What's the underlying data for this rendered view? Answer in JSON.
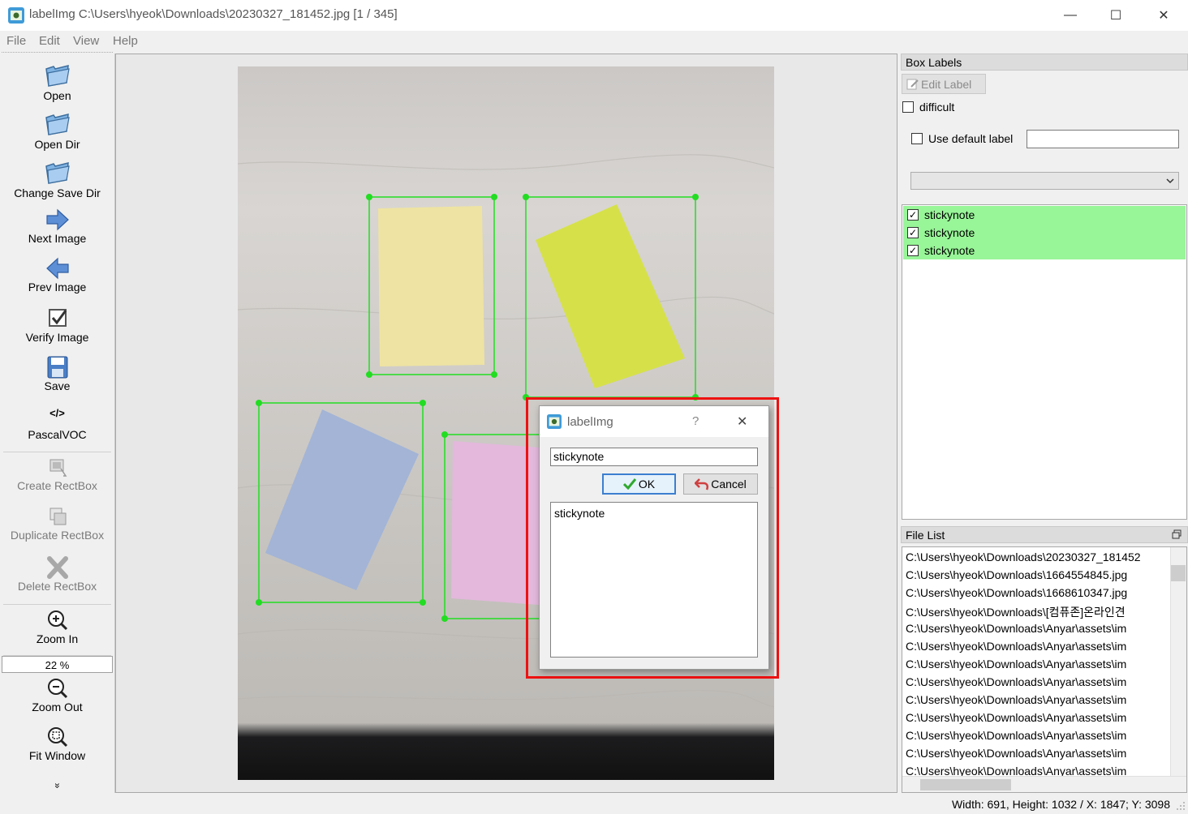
{
  "window": {
    "title": "labelImg C:\\Users\\hyeok\\Downloads\\20230327_181452.jpg [1 / 345]",
    "minimize": "—",
    "maximize": "☐",
    "close": "✕"
  },
  "menu": [
    "File",
    "Edit",
    "View",
    "Help"
  ],
  "toolbar": {
    "open": "Open",
    "open_dir": "Open Dir",
    "change_save_dir": "Change Save Dir",
    "next_image": "Next Image",
    "prev_image": "Prev Image",
    "verify_image": "Verify Image",
    "save": "Save",
    "format_icon_text": "</>",
    "format": "PascalVOC",
    "create_rectbox": "Create RectBox",
    "duplicate_rectbox": "Duplicate RectBox",
    "delete_rectbox": "Delete RectBox",
    "zoom_in": "Zoom In",
    "zoom_value": "22 %",
    "zoom_out": "Zoom Out",
    "fit_window": "Fit Window",
    "more": "»"
  },
  "box_labels": {
    "title": "Box Labels",
    "edit_label": "Edit Label",
    "difficult": "difficult",
    "use_default_label": "Use default label",
    "default_label_value": "",
    "items": [
      {
        "label": "stickynote",
        "checked": true
      },
      {
        "label": "stickynote",
        "checked": true
      },
      {
        "label": "stickynote",
        "checked": true
      }
    ],
    "highlight_color": "#98f598"
  },
  "file_list": {
    "title": "File List",
    "items": [
      "C:\\Users\\hyeok\\Downloads\\20230327_181452",
      "C:\\Users\\hyeok\\Downloads\\1664554845.jpg",
      "C:\\Users\\hyeok\\Downloads\\1668610347.jpg",
      "C:\\Users\\hyeok\\Downloads\\[컴퓨존]온라인견",
      "C:\\Users\\hyeok\\Downloads\\Anyar\\assets\\im",
      "C:\\Users\\hyeok\\Downloads\\Anyar\\assets\\im",
      "C:\\Users\\hyeok\\Downloads\\Anyar\\assets\\im",
      "C:\\Users\\hyeok\\Downloads\\Anyar\\assets\\im",
      "C:\\Users\\hyeok\\Downloads\\Anyar\\assets\\im",
      "C:\\Users\\hyeok\\Downloads\\Anyar\\assets\\im",
      "C:\\Users\\hyeok\\Downloads\\Anyar\\assets\\im",
      "C:\\Users\\hyeok\\Downloads\\Anyar\\assets\\im",
      "C:\\Users\\hyeok\\Downloads\\Anyar\\assets\\im"
    ]
  },
  "status": "Width: 691, Height: 1032 / X: 1847; Y: 3098",
  "dialog": {
    "title": "labelImg",
    "help": "?",
    "close": "✕",
    "input_value": "stickynote",
    "ok": "OK",
    "cancel": "Cancel",
    "list": [
      "stickynote"
    ]
  },
  "colors": {
    "bbox": "#22dd22",
    "highlight": "#ee1111",
    "label_row": "#98f598"
  }
}
